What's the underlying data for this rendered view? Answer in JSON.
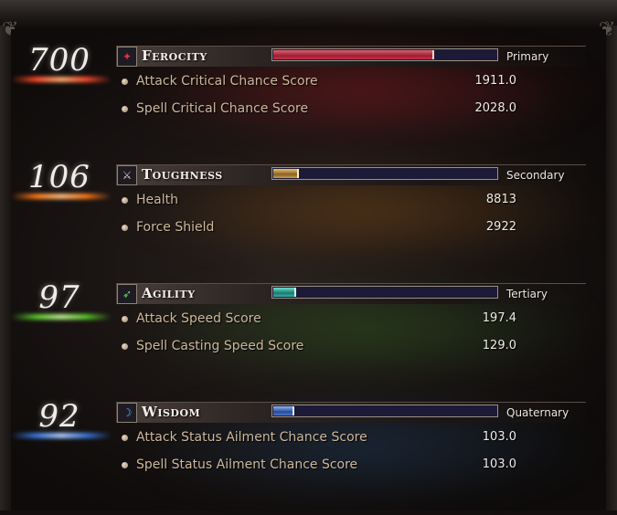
{
  "attributes": [
    {
      "value": "700",
      "name": "Ferocity",
      "rank": "Primary",
      "bar_fill_fraction": 0.71,
      "color": "#c8324a",
      "glow": "#8a1c22",
      "icon": "ferocity-icon",
      "stats": [
        {
          "label": "Attack Critical Chance Score",
          "value": "1911.0"
        },
        {
          "label": "Spell Critical Chance Score",
          "value": "2028.0"
        }
      ]
    },
    {
      "value": "106",
      "name": "Toughness",
      "rank": "Secondary",
      "bar_fill_fraction": 0.11,
      "color": "#c8a050",
      "glow": "#7a4a18",
      "icon": "toughness-icon",
      "stats": [
        {
          "label": "Health",
          "value": "8813"
        },
        {
          "label": "Force Shield",
          "value": "2922"
        }
      ]
    },
    {
      "value": "97",
      "name": "Agility",
      "rank": "Tertiary",
      "bar_fill_fraction": 0.1,
      "color": "#3ab0a8",
      "glow": "#2f5a22",
      "icon": "agility-icon",
      "stats": [
        {
          "label": "Attack Speed Score",
          "value": "197.4"
        },
        {
          "label": "Spell Casting Speed Score",
          "value": "129.0"
        }
      ]
    },
    {
      "value": "92",
      "name": "Wisdom",
      "rank": "Quaternary",
      "bar_fill_fraction": 0.09,
      "color": "#4a78c8",
      "glow": "#1d3a5a",
      "icon": "wisdom-icon",
      "stats": [
        {
          "label": "Attack Status Ailment Chance Score",
          "value": "103.0"
        },
        {
          "label": "Spell Status Ailment Chance Score",
          "value": "103.0"
        }
      ]
    }
  ]
}
